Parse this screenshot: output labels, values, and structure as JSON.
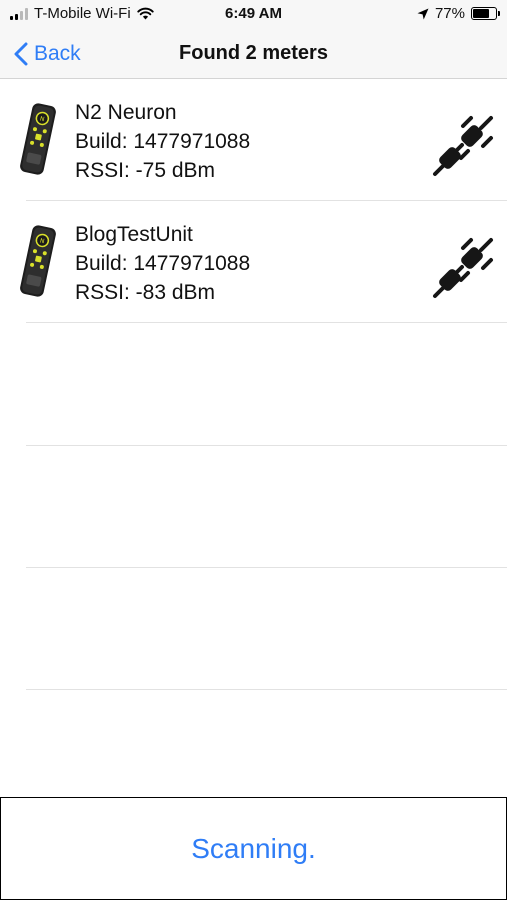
{
  "status_bar": {
    "carrier": "T-Mobile Wi-Fi",
    "time": "6:49 AM",
    "battery_percent": "77%",
    "battery_level": 0.77
  },
  "nav": {
    "back_label": "Back",
    "title": "Found 2 meters"
  },
  "meters": [
    {
      "name": "N2 Neuron",
      "build": "Build: 1477971088",
      "rssi": "RSSI: -75 dBm"
    },
    {
      "name": "BlogTestUnit",
      "build": "Build: 1477971088",
      "rssi": "RSSI: -83 dBm"
    }
  ],
  "footer": {
    "status_label": "Scanning."
  },
  "colors": {
    "accent": "#2f7df6",
    "separator": "#e2e2e2"
  }
}
